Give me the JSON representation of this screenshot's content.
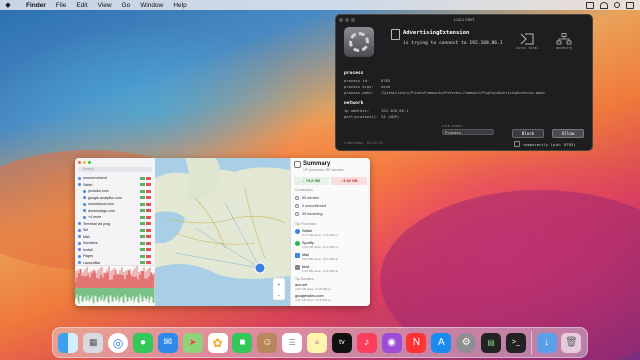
{
  "menubar": {
    "apple": "",
    "items": [
      "Finder",
      "File",
      "Edit",
      "View",
      "Go",
      "Window",
      "Help"
    ]
  },
  "lulu": {
    "window_title": "LuLu Alert",
    "process_name": "AdvertisingExtension",
    "message_prefix": "is trying to connect to",
    "address": "192.168.86.1",
    "virustotal_label": "virus total",
    "ancestry_label": "ancestry",
    "process_section": "process",
    "process_rows": [
      {
        "key": "process id:",
        "value": "8783"
      },
      {
        "key": "process args:",
        "value": "none"
      },
      {
        "key": "process path:",
        "value": "/System/Library/PrivateFrameworks/Preferenc…framework/PlugIns/AdvertisingExtension.appex"
      }
    ],
    "network_section": "network",
    "network_rows": [
      {
        "key": "ip address:",
        "value": "192.168.86.1"
      },
      {
        "key": "port(protocol):",
        "value": "53 (UDP)"
      }
    ],
    "rule_scope_label": "rule scope:",
    "scope_value": "Process",
    "block_label": "Block",
    "allow_label": "Allow",
    "timestamp": "timestamp: 20:14:33",
    "temporarily_label": "temporarily (pid: 8783)"
  },
  "snitch": {
    "search_placeholder": "Search",
    "tree": [
      {
        "label": "neuroevolment",
        "depth": 0
      },
      {
        "label": "Safari",
        "depth": 0
      },
      {
        "label": "youtube.com",
        "depth": 1
      },
      {
        "label": "google-analytics.com",
        "depth": 1
      },
      {
        "label": "soundcloud.com",
        "depth": 1
      },
      {
        "label": "duckduckgo.com",
        "depth": 1
      },
      {
        "label": "+4 more",
        "depth": 1
      },
      {
        "label": "Terminal via ping",
        "depth": 0
      },
      {
        "label": "Siri",
        "depth": 0
      },
      {
        "label": "Mail",
        "depth": 0
      },
      {
        "label": "Numbers",
        "depth": 0
      },
      {
        "label": "Install",
        "depth": 0
      },
      {
        "label": "Pages",
        "depth": 0
      },
      {
        "label": "LaunchBar",
        "depth": 0
      },
      {
        "label": "bind",
        "depth": 0
      }
    ],
    "summary_title": "Summary",
    "summary_sub": "157 processes, 397 domains",
    "incoming_traffic": "↓ 79,5 GB",
    "outgoing_traffic": "↑ 8.94 GB",
    "connections_label": "Connections",
    "conn_rows": [
      "55 denied",
      "0 unconfirmed",
      "39 incoming"
    ],
    "processes_label": "Top Processes",
    "processes": [
      {
        "name": "Safari",
        "detail": "9,47 GB down, 1,45 GB up"
      },
      {
        "name": "Spotify",
        "detail": "1,99 GB down, 51,2 MB up"
      },
      {
        "name": "Mail",
        "detail": "19,5 MB down, 93,6 MB up"
      },
      {
        "name": "bind",
        "detail": "1,25 MB down, 2,61 MB up"
      }
    ],
    "domains_label": "Top Domains",
    "domains": [
      {
        "name": "aco.net",
        "detail": "4,95 GB down, 9,46 MB up"
      },
      {
        "name": "googlevideo.com",
        "detail": "4,69 GB down, 14,8 MB up"
      }
    ]
  },
  "colors": {
    "accent": "#4a8ad9",
    "allow_green": "#59b36a",
    "deny_red": "#e05353",
    "lulu_block": "#3a3a3f",
    "lulu_allow": "#4c4c52"
  },
  "dock": [
    "finder-icon",
    "launchpad-icon",
    "safari-icon",
    "messages-icon",
    "mail-icon",
    "maps-icon",
    "photos-icon",
    "facetime-icon",
    "contacts-icon",
    "reminders-icon",
    "notes-icon",
    "appletv-icon",
    "music-icon",
    "podcasts-icon",
    "news-icon",
    "appstore-icon",
    "system-preferences-icon",
    "little-snitch-icon",
    "terminal-icon",
    "downloads-icon",
    "trash-icon"
  ]
}
